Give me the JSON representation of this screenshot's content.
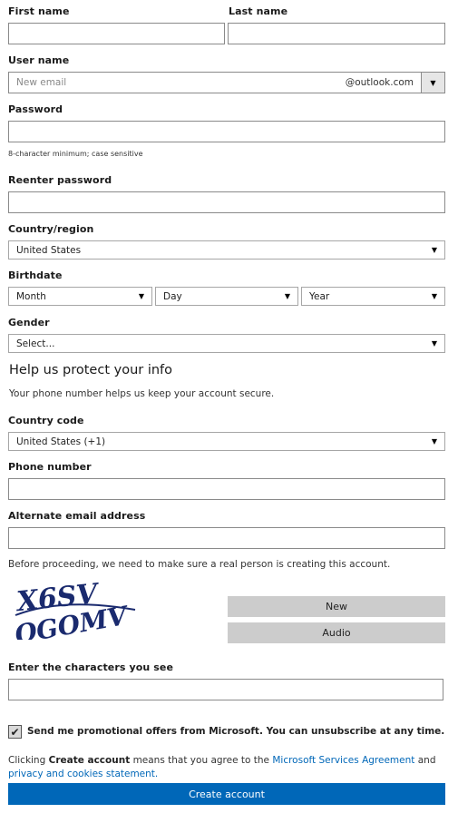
{
  "form": {
    "first_name_label": "First name",
    "last_name_label": "Last name",
    "username_label": "User name",
    "username_placeholder": "New email",
    "domain": "@outlook.com",
    "password_label": "Password",
    "password_hint": "8-character minimum; case sensitive",
    "reenter_label": "Reenter password",
    "country_label": "Country/region",
    "country_value": "United States",
    "birthdate_label": "Birthdate",
    "month_value": "Month",
    "day_value": "Day",
    "year_value": "Year",
    "gender_label": "Gender",
    "gender_value": "Select..."
  },
  "protect": {
    "heading": "Help us protect your info",
    "subtext": "Your phone number helps us keep your account secure.",
    "country_code_label": "Country code",
    "country_code_value": "United States (+1)",
    "phone_label": "Phone number",
    "alt_email_label": "Alternate email address"
  },
  "captcha": {
    "intro": "Before proceeding, we need to make sure a real person is creating this account.",
    "image_text_top": "X6SV",
    "image_text_bottom": "QGOMV",
    "new_label": "New",
    "audio_label": "Audio",
    "enter_label": "Enter the characters you see"
  },
  "consent": {
    "checked": true,
    "promo_text": "Send me promotional offers from Microsoft. You can unsubscribe at any time.",
    "clicking": "Clicking",
    "create_account_bold": "Create account",
    "means_agree": "means that you agree to the",
    "msa_link": "Microsoft Services Agreement",
    "and_word": "and",
    "privacy_link": "privacy and cookies statement.",
    "submit_label": "Create account"
  },
  "colors": {
    "accent": "#0067b8",
    "button_gray": "#cccccc"
  }
}
